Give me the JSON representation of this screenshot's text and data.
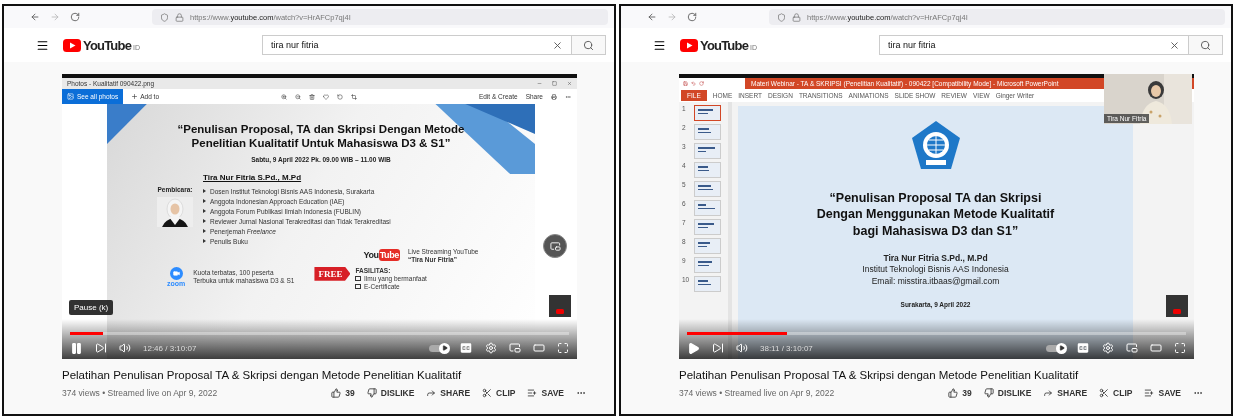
{
  "panels": [
    {
      "browser": {
        "url": "https://www.**youtube.com**/watch?v=HrAFCp7qj4I"
      },
      "youtube": {
        "logo": "YouTube",
        "region": "ID",
        "search": {
          "value": "tira nur fitria"
        }
      },
      "video": {
        "kind": "photos",
        "playing": true,
        "autoplay": true,
        "level": 0.067,
        "time": "12:46 / 3:10:07",
        "tooltip": "Pause (k)",
        "photos": {
          "title": "Photos - Kualitatif 090422.png",
          "see_all": "See all photos",
          "add_to": "Add to",
          "edit": "Edit & Create",
          "share": "Share"
        },
        "slide": {
          "title_lines": [
            "“Penulisan Proposal, TA dan Skripsi Dengan Metode",
            "Penelitian Kualitatif Untuk Mahasiswa D3 & S1”"
          ],
          "date": "Sabtu, 9 April 2022 Pk. 09.00 WIB – 11.00 WIB",
          "speaker_label": "Pembicara:",
          "speaker": "Tira Nur Fitria S.Pd., M.Pd",
          "bullets": [
            "Dosen Institut Teknologi Bisnis AAS Indonesia, Surakarta",
            "Anggota Indonesian Approach Education (IAE)",
            "Anggota Forum Publikasi Ilmiah Indonesia (FUBLIN)",
            "Reviewer Jurnal Nasional Terakreditasi dan Tidak Terakreditasi",
            "Penerjemah *Freelance*",
            "Penulis Buku"
          ],
          "youtube_logo": [
            "You",
            "Tube"
          ],
          "live": [
            "Live Streaming YouTube",
            "“Tira Nur Fitria”"
          ],
          "zoom_logo": "zoom",
          "quota": [
            "Kuota terbatas, 100 peserta",
            "Terbuka untuk mahasiswa D3 & S1"
          ],
          "free": "FREE",
          "facilities_label": "FASILITAS:",
          "facilities": [
            {
              "label": "Ilmu yang bermanfaat",
              "checked": false
            },
            {
              "label": "E-Certificate",
              "checked": false
            }
          ]
        }
      },
      "title": "Pelatihan Penulisan Proposal TA & Skripsi dengan Metode Penelitian Kualitatif",
      "meta": "374 views • Streamed live on Apr 9, 2022",
      "actions": [
        {
          "kind": "like",
          "label": "39"
        },
        {
          "kind": "dislike",
          "label": "DISLIKE"
        },
        {
          "kind": "share",
          "label": "SHARE"
        },
        {
          "kind": "clip",
          "label": "CLIP"
        },
        {
          "kind": "save",
          "label": "SAVE"
        },
        {
          "kind": "more"
        }
      ]
    },
    {
      "browser": {
        "url": "https://www.**youtube.com**/watch?v=HrAFCp7qj4I"
      },
      "youtube": {
        "logo": "YouTube",
        "region": "ID",
        "search": {
          "value": "tira nur fitria"
        }
      },
      "video": {
        "kind": "powerpoint",
        "playing": false,
        "autoplay": true,
        "level": 0.2,
        "time": "38:11 / 3:10:07",
        "ppt": {
          "title": "Materi Webinar - TA & SKRIPSI (Penelitian Kualitatif) - 090422 [Compatibility Mode] - Microsoft PowerPoint",
          "file": "FILE",
          "tabs": [
            "HOME",
            "INSERT",
            "DESIGN",
            "TRANSITIONS",
            "ANIMATIONS",
            "SLIDE SHOW",
            "REVIEW",
            "VIEW",
            "Ginger Writer"
          ],
          "thumbnails": [
            {
              "number": "1",
              "selected": true
            },
            {
              "number": "2",
              "selected": false
            },
            {
              "number": "3",
              "selected": false
            },
            {
              "number": "4",
              "selected": false
            },
            {
              "number": "5",
              "selected": false
            },
            {
              "number": "6",
              "selected": false
            },
            {
              "number": "7",
              "selected": false
            },
            {
              "number": "8",
              "selected": false
            },
            {
              "number": "9",
              "selected": false
            },
            {
              "number": "10",
              "selected": false
            }
          ]
        },
        "slide": {
          "title_lines": [
            "“Penulisan Proposal TA dan Skripsi",
            "Dengan Menggunakan Metode Kualitatif",
            "bagi Mahasiswa D3 dan S1”"
          ],
          "name": "Tira Nur Fitria S.Pd., M.Pd",
          "institution": "Institut Teknologi Bisnis AAS Indonesia",
          "email": "Email: misstira.itbaas@gmail.com",
          "place_date": "Surakarta, 9 April 2022"
        },
        "webcam": {
          "label": "Tira Nur Fitria"
        }
      },
      "title": "Pelatihan Penulisan Proposal TA & Skripsi dengan Metode Penelitian Kualitatif",
      "meta": "374 views • Streamed live on Apr 9, 2022",
      "actions": [
        {
          "kind": "like",
          "label": "39"
        },
        {
          "kind": "dislike",
          "label": "DISLIKE"
        },
        {
          "kind": "share",
          "label": "SHARE"
        },
        {
          "kind": "clip",
          "label": "CLIP"
        },
        {
          "kind": "save",
          "label": "SAVE"
        },
        {
          "kind": "more"
        }
      ]
    }
  ]
}
